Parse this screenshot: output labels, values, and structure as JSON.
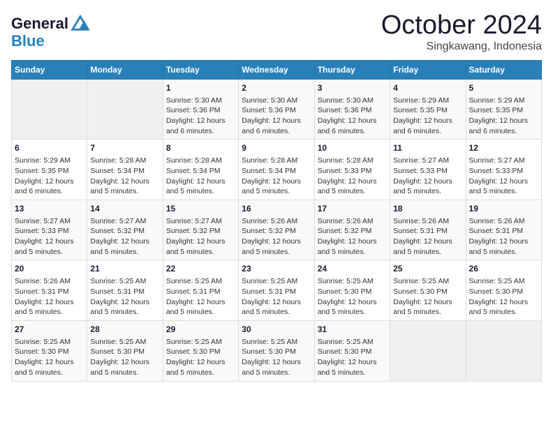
{
  "logo": {
    "text_general": "General",
    "text_blue": "Blue"
  },
  "title": "October 2024",
  "subtitle": "Singkawang, Indonesia",
  "days_of_week": [
    "Sunday",
    "Monday",
    "Tuesday",
    "Wednesday",
    "Thursday",
    "Friday",
    "Saturday"
  ],
  "weeks": [
    [
      {
        "day": "",
        "info": ""
      },
      {
        "day": "",
        "info": ""
      },
      {
        "day": "1",
        "info": "Sunrise: 5:30 AM\nSunset: 5:36 PM\nDaylight: 12 hours\nand 6 minutes."
      },
      {
        "day": "2",
        "info": "Sunrise: 5:30 AM\nSunset: 5:36 PM\nDaylight: 12 hours\nand 6 minutes."
      },
      {
        "day": "3",
        "info": "Sunrise: 5:30 AM\nSunset: 5:36 PM\nDaylight: 12 hours\nand 6 minutes."
      },
      {
        "day": "4",
        "info": "Sunrise: 5:29 AM\nSunset: 5:35 PM\nDaylight: 12 hours\nand 6 minutes."
      },
      {
        "day": "5",
        "info": "Sunrise: 5:29 AM\nSunset: 5:35 PM\nDaylight: 12 hours\nand 6 minutes."
      }
    ],
    [
      {
        "day": "6",
        "info": "Sunrise: 5:29 AM\nSunset: 5:35 PM\nDaylight: 12 hours\nand 6 minutes."
      },
      {
        "day": "7",
        "info": "Sunrise: 5:28 AM\nSunset: 5:34 PM\nDaylight: 12 hours\nand 5 minutes."
      },
      {
        "day": "8",
        "info": "Sunrise: 5:28 AM\nSunset: 5:34 PM\nDaylight: 12 hours\nand 5 minutes."
      },
      {
        "day": "9",
        "info": "Sunrise: 5:28 AM\nSunset: 5:34 PM\nDaylight: 12 hours\nand 5 minutes."
      },
      {
        "day": "10",
        "info": "Sunrise: 5:28 AM\nSunset: 5:33 PM\nDaylight: 12 hours\nand 5 minutes."
      },
      {
        "day": "11",
        "info": "Sunrise: 5:27 AM\nSunset: 5:33 PM\nDaylight: 12 hours\nand 5 minutes."
      },
      {
        "day": "12",
        "info": "Sunrise: 5:27 AM\nSunset: 5:33 PM\nDaylight: 12 hours\nand 5 minutes."
      }
    ],
    [
      {
        "day": "13",
        "info": "Sunrise: 5:27 AM\nSunset: 5:33 PM\nDaylight: 12 hours\nand 5 minutes."
      },
      {
        "day": "14",
        "info": "Sunrise: 5:27 AM\nSunset: 5:32 PM\nDaylight: 12 hours\nand 5 minutes."
      },
      {
        "day": "15",
        "info": "Sunrise: 5:27 AM\nSunset: 5:32 PM\nDaylight: 12 hours\nand 5 minutes."
      },
      {
        "day": "16",
        "info": "Sunrise: 5:26 AM\nSunset: 5:32 PM\nDaylight: 12 hours\nand 5 minutes."
      },
      {
        "day": "17",
        "info": "Sunrise: 5:26 AM\nSunset: 5:32 PM\nDaylight: 12 hours\nand 5 minutes."
      },
      {
        "day": "18",
        "info": "Sunrise: 5:26 AM\nSunset: 5:31 PM\nDaylight: 12 hours\nand 5 minutes."
      },
      {
        "day": "19",
        "info": "Sunrise: 5:26 AM\nSunset: 5:31 PM\nDaylight: 12 hours\nand 5 minutes."
      }
    ],
    [
      {
        "day": "20",
        "info": "Sunrise: 5:26 AM\nSunset: 5:31 PM\nDaylight: 12 hours\nand 5 minutes."
      },
      {
        "day": "21",
        "info": "Sunrise: 5:25 AM\nSunset: 5:31 PM\nDaylight: 12 hours\nand 5 minutes."
      },
      {
        "day": "22",
        "info": "Sunrise: 5:25 AM\nSunset: 5:31 PM\nDaylight: 12 hours\nand 5 minutes."
      },
      {
        "day": "23",
        "info": "Sunrise: 5:25 AM\nSunset: 5:31 PM\nDaylight: 12 hours\nand 5 minutes."
      },
      {
        "day": "24",
        "info": "Sunrise: 5:25 AM\nSunset: 5:30 PM\nDaylight: 12 hours\nand 5 minutes."
      },
      {
        "day": "25",
        "info": "Sunrise: 5:25 AM\nSunset: 5:30 PM\nDaylight: 12 hours\nand 5 minutes."
      },
      {
        "day": "26",
        "info": "Sunrise: 5:25 AM\nSunset: 5:30 PM\nDaylight: 12 hours\nand 5 minutes."
      }
    ],
    [
      {
        "day": "27",
        "info": "Sunrise: 5:25 AM\nSunset: 5:30 PM\nDaylight: 12 hours\nand 5 minutes."
      },
      {
        "day": "28",
        "info": "Sunrise: 5:25 AM\nSunset: 5:30 PM\nDaylight: 12 hours\nand 5 minutes."
      },
      {
        "day": "29",
        "info": "Sunrise: 5:25 AM\nSunset: 5:30 PM\nDaylight: 12 hours\nand 5 minutes."
      },
      {
        "day": "30",
        "info": "Sunrise: 5:25 AM\nSunset: 5:30 PM\nDaylight: 12 hours\nand 5 minutes."
      },
      {
        "day": "31",
        "info": "Sunrise: 5:25 AM\nSunset: 5:30 PM\nDaylight: 12 hours\nand 5 minutes."
      },
      {
        "day": "",
        "info": ""
      },
      {
        "day": "",
        "info": ""
      }
    ]
  ]
}
